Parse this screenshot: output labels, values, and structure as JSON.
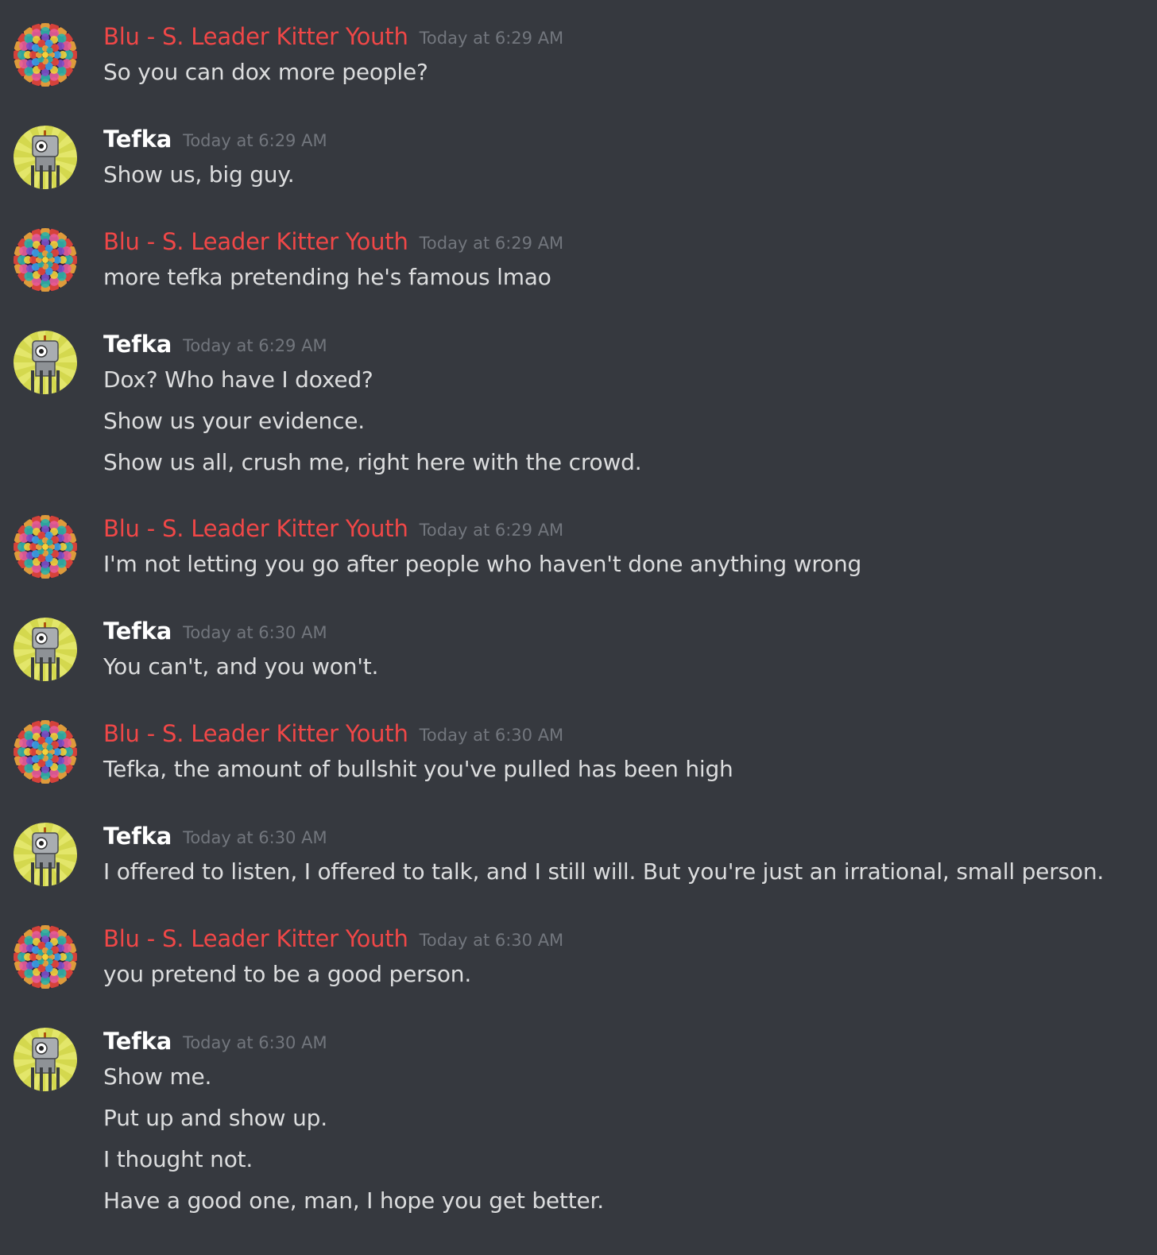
{
  "colors": {
    "background": "#36393f",
    "blu_name": "#f04747",
    "tefka_name": "#ffffff",
    "message_text": "#dcddde",
    "timestamp": "#72767d"
  },
  "messages": [
    {
      "author": "Blu - S. Leader Kitter Youth",
      "avatar_icon": "mandala-avatar-icon",
      "time": "Today at 6:29 AM",
      "lines": [
        "So you can dox more people?"
      ]
    },
    {
      "author": "Tefka",
      "avatar_icon": "robot-avatar-icon",
      "time": "Today at 6:29 AM",
      "lines": [
        "Show us, big guy."
      ]
    },
    {
      "author": "Blu - S. Leader Kitter Youth",
      "avatar_icon": "mandala-avatar-icon",
      "time": "Today at 6:29 AM",
      "lines": [
        "more tefka pretending he's famous lmao"
      ]
    },
    {
      "author": "Tefka",
      "avatar_icon": "robot-avatar-icon",
      "time": "Today at 6:29 AM",
      "lines": [
        "Dox? Who have I doxed?",
        "Show us your evidence.",
        "Show us all, crush me, right here with the crowd."
      ]
    },
    {
      "author": "Blu - S. Leader Kitter Youth",
      "avatar_icon": "mandala-avatar-icon",
      "time": "Today at 6:29 AM",
      "lines": [
        "I'm not letting you go after people who haven't done anything wrong"
      ]
    },
    {
      "author": "Tefka",
      "avatar_icon": "robot-avatar-icon",
      "time": "Today at 6:30 AM",
      "lines": [
        "You can't, and you won't."
      ]
    },
    {
      "author": "Blu - S. Leader Kitter Youth",
      "avatar_icon": "mandala-avatar-icon",
      "time": "Today at 6:30 AM",
      "lines": [
        "Tefka, the amount of bullshit you've pulled has been high"
      ]
    },
    {
      "author": "Tefka",
      "avatar_icon": "robot-avatar-icon",
      "time": "Today at 6:30 AM",
      "lines": [
        "I offered to listen, I offered to talk, and I still will. But you're just an irrational, small person."
      ]
    },
    {
      "author": "Blu - S. Leader Kitter Youth",
      "avatar_icon": "mandala-avatar-icon",
      "time": "Today at 6:30 AM",
      "lines": [
        "you pretend to be a good person."
      ]
    },
    {
      "author": "Tefka",
      "avatar_icon": "robot-avatar-icon",
      "time": "Today at 6:30 AM",
      "lines": [
        "Show me.",
        "Put up and show up.",
        "I thought not.",
        "Have a good one, man, I hope you get better."
      ]
    }
  ]
}
